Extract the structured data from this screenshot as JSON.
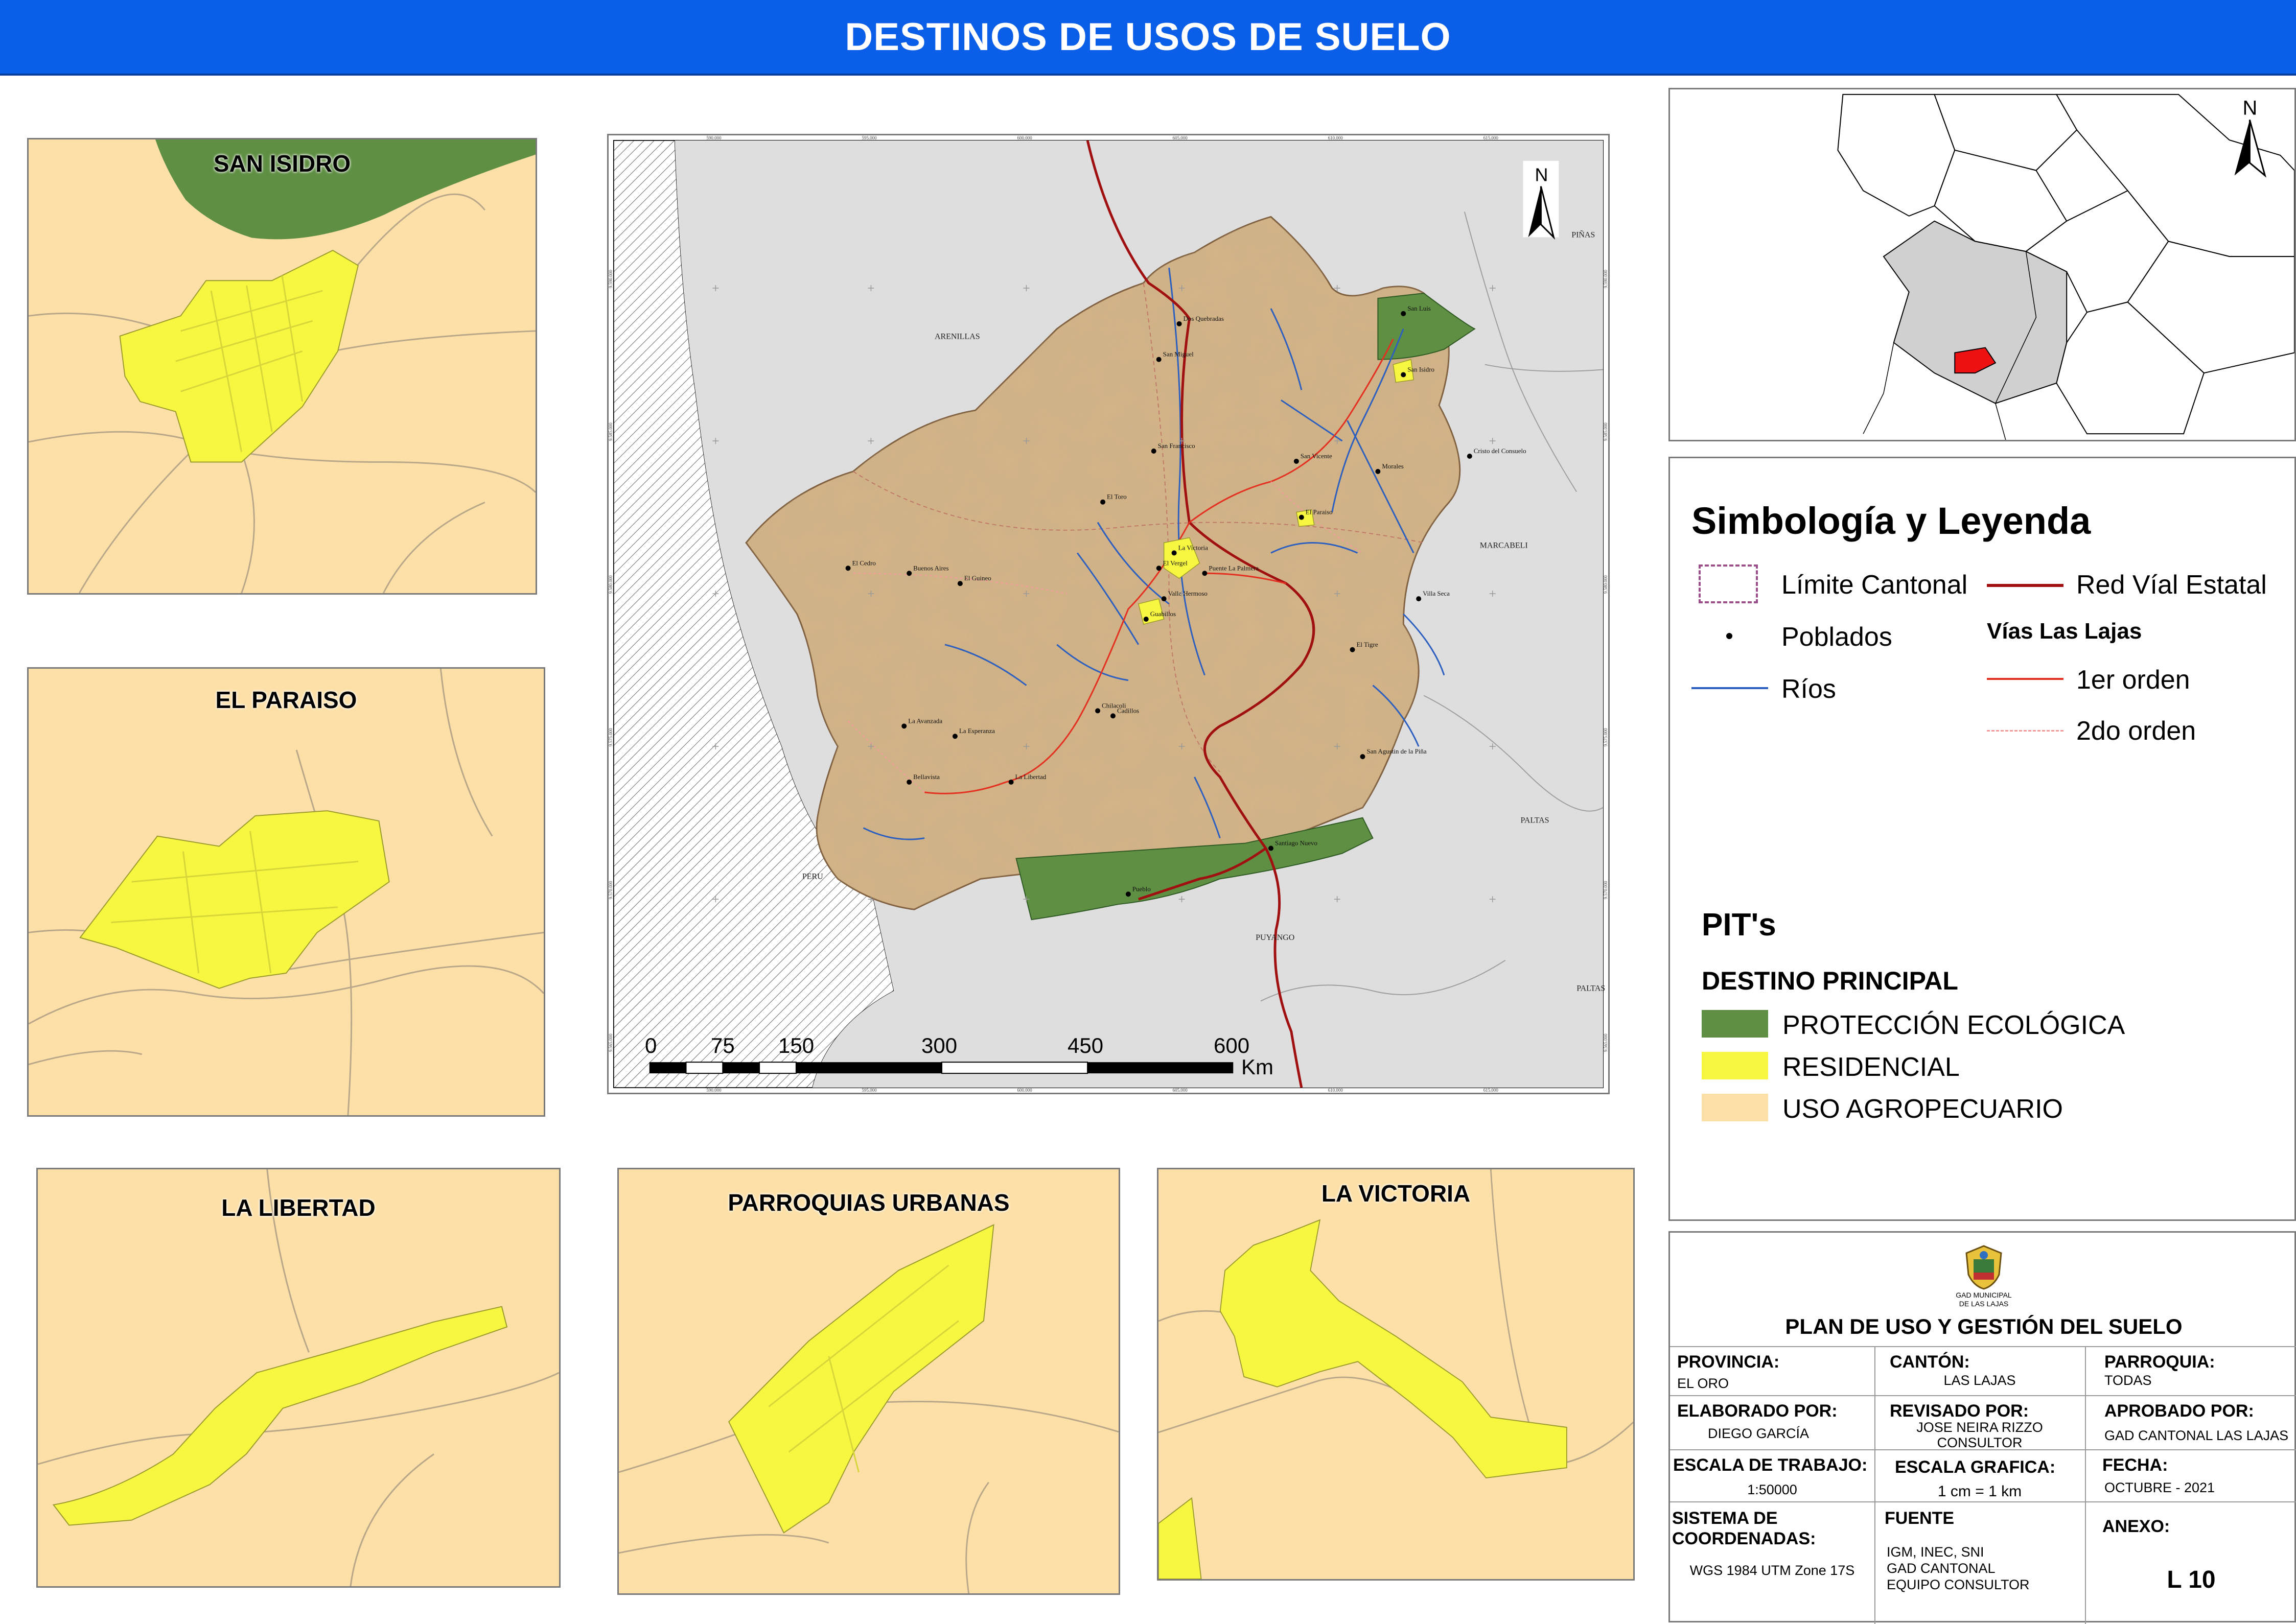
{
  "header": {
    "title": "DESTINOS DE USOS DE SUELO"
  },
  "colors": {
    "title_bar": "#0b5ee8",
    "proteccion_ecologica": "#5f8f43",
    "residencial": "#f7f742",
    "uso_agropecuario": "#fde0a7",
    "red_vial_estatal": "#a01010",
    "vias_1er_orden": "#e43020",
    "vias_2do_orden": "#f29a9a",
    "rios": "#2c5fbf",
    "limite_cantonal": "#9a4f8a"
  },
  "insets": {
    "san_isidro": "SAN ISIDRO",
    "el_paraiso": "EL PARAISO",
    "la_libertad": "LA LIBERTAD",
    "parroquias_urbanas": "PARROQUIAS URBANAS",
    "la_victoria": "LA VICTORIA"
  },
  "main_map": {
    "north_label": "N",
    "regions": {
      "arenillas": "ARENILLAS",
      "marcabeli": "MARCABELI",
      "peru": "PERU",
      "paltas": "PALTAS",
      "puyango": "PUYANGO",
      "pinas": "PIÑAS"
    },
    "places": [
      "Dos Quebradas",
      "San Luis",
      "San Miguel",
      "San Isidro",
      "San Francisco",
      "Cristo del Consuelo",
      "San Vicente",
      "Morales",
      "El Toro",
      "El Paraiso",
      "La Victoria",
      "El Vergel",
      "Puente La Palmera",
      "El Cedro",
      "Buenos Aires",
      "El Guineo",
      "Valle Hermoso",
      "Guabillos",
      "Villa Seca",
      "El Tigre",
      "Chilacoli",
      "Cadillos",
      "La Avanzada",
      "La Esperanza",
      "San Agustin de la Piña",
      "Bellavista",
      "La Libertad",
      "Santiago Nuevo",
      "Pueblo"
    ],
    "coords_top": [
      "590.000",
      "595.000",
      "600.000",
      "605.000",
      "610.000",
      "615.000"
    ],
    "coords_bottom": [
      "590.000",
      "595.000",
      "600.000",
      "605.000",
      "610.000",
      "615.000"
    ],
    "coords_left": [
      "9.590.000",
      "9.585.000",
      "9.580.000",
      "9.575.000",
      "9.570.000",
      "9.565.000"
    ],
    "coords_right": [
      "9.590.000",
      "9.585.000",
      "9.580.000",
      "9.575.000",
      "9.570.000",
      "9.565.000"
    ],
    "scale": {
      "ticks": [
        "0",
        "75",
        "150",
        "300",
        "450",
        "600"
      ],
      "unit": "Km"
    }
  },
  "locator": {
    "north_label": "N"
  },
  "legend": {
    "title": "Simbología y Leyenda",
    "limite_cantonal": "Límite Cantonal",
    "poblados": "Poblados",
    "rios": "Ríos",
    "red_vial_estatal": "Red Víal Estatal",
    "vias_header": "Vías Las Lajas",
    "primer_orden": "1er orden",
    "segundo_orden": "2do orden",
    "pits_title": "PIT's",
    "destino_principal": "DESTINO PRINCIPAL",
    "items": [
      "PROTECCIÓN ECOLÓGICA",
      "RESIDENCIAL",
      "USO AGROPECUARIO"
    ]
  },
  "titleblock": {
    "logo_caption_1": "GAD MUNICIPAL",
    "logo_caption_2": "DE LAS LAJAS",
    "plan_title": "PLAN DE USO Y GESTIÓN DEL SUELO",
    "provincia_label": "PROVINCIA:",
    "provincia_value": "EL ORO",
    "canton_label": "CANTÓN:",
    "canton_value": "LAS LAJAS",
    "parroquia_label": "PARROQUIA:",
    "parroquia_value": "TODAS",
    "elaborado_label": "ELABORADO POR:",
    "elaborado_value": "DIEGO GARCÍA",
    "revisado_label": "REVISADO POR:",
    "revisado_value_1": "JOSE NEIRA RIZZO",
    "revisado_value_2": "CONSULTOR",
    "aprobado_label": "APROBADO POR:",
    "aprobado_value": "GAD CANTONAL LAS LAJAS",
    "escala_trabajo_label": "ESCALA DE TRABAJO:",
    "escala_trabajo_value": "1:50000",
    "escala_grafica_label": "ESCALA GRAFICA:",
    "escala_grafica_value": "1 cm = 1 km",
    "fecha_label": "FECHA:",
    "fecha_value": "OCTUBRE - 2021",
    "sistema_label_1": "SISTEMA DE",
    "sistema_label_2": "COORDENADAS:",
    "sistema_value": "WGS 1984 UTM Zone 17S",
    "fuente_label": "FUENTE",
    "fuente_value_1": "IGM, INEC, SNI",
    "fuente_value_2": "GAD CANTONAL",
    "fuente_value_3": "EQUIPO CONSULTOR",
    "anexo_label": "ANEXO:",
    "anexo_value": "L 10"
  }
}
